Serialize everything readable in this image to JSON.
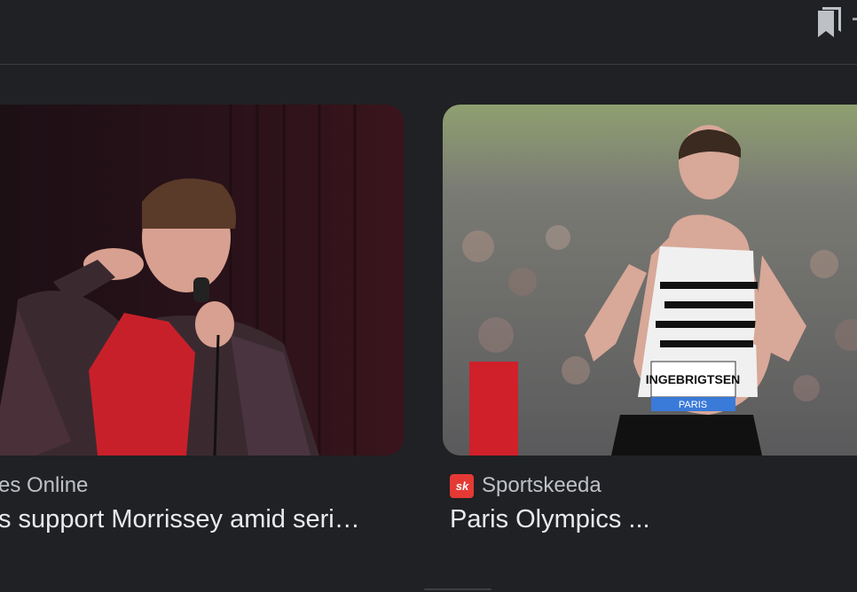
{
  "toolbar": {
    "bookmark_icon": "bookmark-stack-icon"
  },
  "cards": [
    {
      "source": "es Online",
      "headline": "s support Morrissey amid seri…",
      "image_desc_icon": "photo-singer-icon"
    },
    {
      "source": "Sportskeeda",
      "source_logo_text": "sk",
      "headline": "Paris Olympics ...",
      "image_desc_icon": "photo-runner-icon",
      "bib_text": "INGEBRIGTSEN",
      "bib_sub": "PARIS"
    }
  ],
  "colors": {
    "background": "#202124",
    "source_text": "#bdc1c6",
    "headline_text": "#e8eaed",
    "sportskeeda_brand": "#e53935"
  }
}
